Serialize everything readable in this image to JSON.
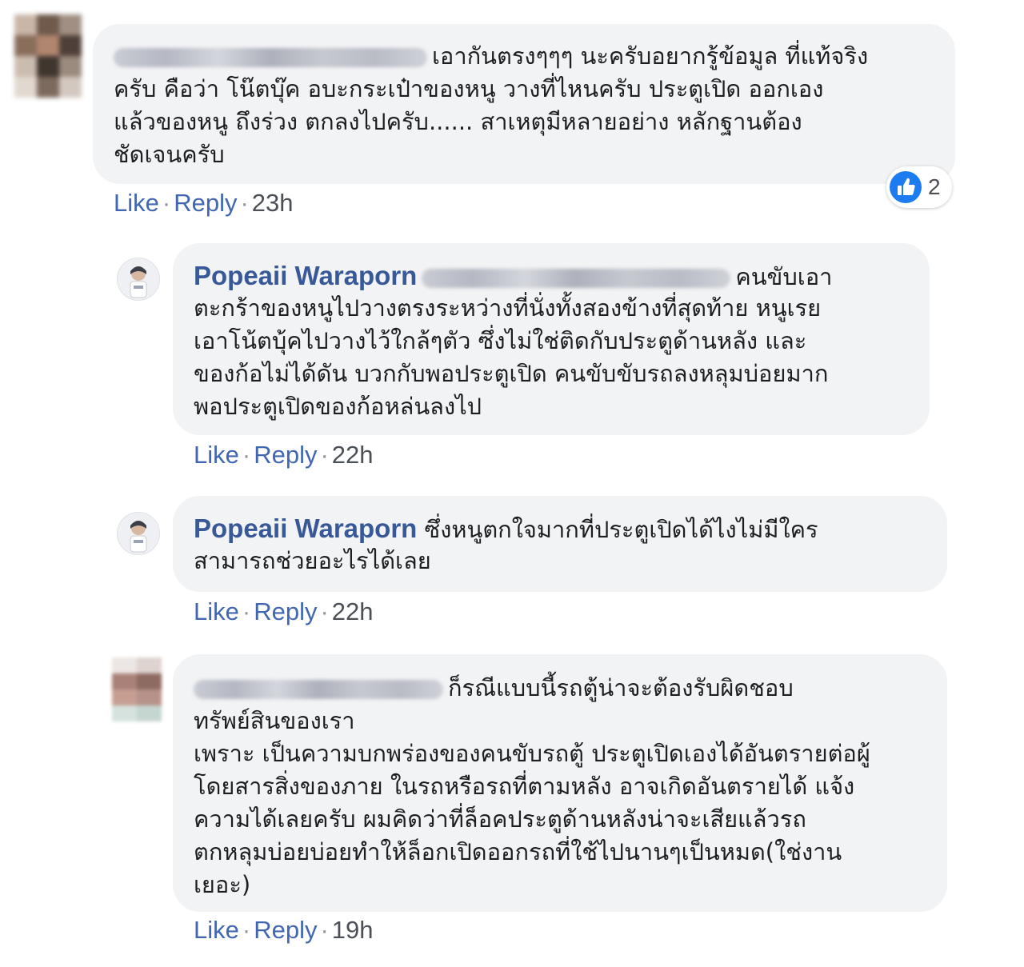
{
  "comments": [
    {
      "author": "",
      "text_lines": [
        "เอากันตรงๆๆๆ นะครับอยากรู้ข้อมูล ที่แท้จริง",
        "ครับ คือว่า โน๊ตบุ๊ค อบะกระเป๋าของหนู วางที่ไหนครับ ประตูเปิด ออกเอง",
        "แล้วของหนู ถึงร่วง ตกลงไปครับ...... สาเหตุมีหลายอย่าง หลักฐานต้อง",
        "ชัดเจนครับ"
      ],
      "actions": {
        "like": "Like",
        "reply": "Reply",
        "time": "23h"
      },
      "reaction_count": "2"
    },
    {
      "author": "Popeaii Waraporn",
      "text_lines": [
        "คนขับเอา",
        "ตะกร้าของหนูไปวางตรงระหว่างที่นั่งทั้งสองข้างที่สุดท้าย หนูเรย",
        "เอาโน้ตบุ้คไปวางไว้ใกล้ๆตัว ซึ่งไม่ใช่ติดกับประตูด้านหลัง และ",
        "ของก้อไม่ได้ดัน บวกกับพอประตูเปิด คนขับขับรถลงหลุมบ่อยมาก",
        "พอประตูเปิดของก้อหล่นลงไป"
      ],
      "actions": {
        "like": "Like",
        "reply": "Reply",
        "time": "22h"
      }
    },
    {
      "author": "Popeaii Waraporn",
      "text_lines": [
        "ซึ่งหนูตกใจมากที่ประตูเปิดได้ไงไม่มีใคร",
        "สามารถช่วยอะไรได้เลย"
      ],
      "actions": {
        "like": "Like",
        "reply": "Reply",
        "time": "22h"
      }
    },
    {
      "author": "",
      "text_lines": [
        "ก็รณีแบบนี้รถตู้น่าจะต้องรับผิดชอบ",
        "ทรัพย์สินของเรา",
        "เพราะ เป็นความบกพร่องของคนขับรถตู้ ประตูเปิดเองได้อันตรายต่อผู้",
        "โดยสารสิ่งของภาย ในรถหรือรถที่ตามหลัง อาจเกิดอันตรายได้ แจ้ง",
        "ความได้เลยครับ ผมคิดว่าที่ล็อคประตูด้านหลังน่าจะเสียแล้วรถ",
        "ตกหลุมบ่อยบ่อยทำให้ล็อกเปิดออกรถที่ใช้ไปนานๆเป็นหมด(ใช่งาน",
        "เยอะ)"
      ],
      "actions": {
        "like": "Like",
        "reply": "Reply",
        "time": "19h"
      }
    }
  ],
  "colors": {
    "bubble": "#f2f3f5",
    "author": "#385898",
    "link": "#4267b2",
    "like_icon": "#1d7bf2"
  },
  "icons": {
    "reaction": "like-thumb-icon",
    "avatar": "profile-avatar-icon"
  }
}
